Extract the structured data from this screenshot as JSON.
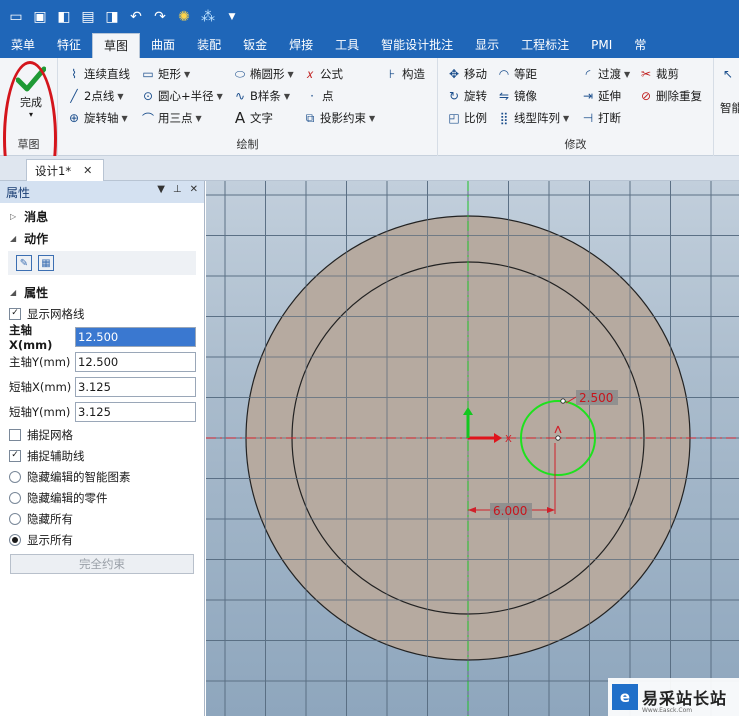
{
  "quick_access": [
    "new-icon",
    "open-icon",
    "save-icon",
    "folder-icon",
    "disk-icon",
    "undo-icon",
    "redo-icon",
    "gear-icon",
    "sparkle-icon",
    "dropdown-icon"
  ],
  "menu": {
    "tabs": [
      "菜单",
      "特征",
      "草图",
      "曲面",
      "装配",
      "钣金",
      "焊接",
      "工具",
      "智能设计批注",
      "显示",
      "工程标注",
      "PMI",
      "常"
    ],
    "active_index": 2
  },
  "ribbon": {
    "finish": {
      "label": "完成",
      "group": "草图"
    },
    "draw": {
      "group": "绘制",
      "items": [
        "连续直线",
        "矩形",
        "椭圆形",
        "公式",
        "构造",
        "2点线",
        "圆心+半径",
        "B样条",
        "点",
        "旋转轴",
        "用三点",
        "文字",
        "投影约束"
      ]
    },
    "modify": {
      "group": "修改",
      "items": [
        "移动",
        "等距",
        "过渡",
        "裁剪",
        "旋转",
        "镜像",
        "延伸",
        "删除重复",
        "比例",
        "线型阵列",
        "打断"
      ]
    },
    "extra": "智能"
  },
  "document": {
    "tab": "设计1*"
  },
  "panel": {
    "title": "属性",
    "sections": {
      "messages": "消息",
      "actions": "动作",
      "properties": "属性"
    },
    "show_grid": {
      "label": "显示网格线",
      "checked": true
    },
    "fields": [
      {
        "label": "主轴X(mm)",
        "value": "12.500"
      },
      {
        "label": "主轴Y(mm)",
        "value": "12.500"
      },
      {
        "label": "短轴X(mm)",
        "value": "3.125"
      },
      {
        "label": "短轴Y(mm)",
        "value": "3.125"
      }
    ],
    "snap_grid": {
      "label": "捕捉网格",
      "checked": false
    },
    "snap_guide": {
      "label": "捕捉辅助线",
      "checked": true
    },
    "radios": [
      {
        "label": "隐藏编辑的智能图素",
        "checked": false
      },
      {
        "label": "隐藏编辑的零件",
        "checked": false
      },
      {
        "label": "隐藏所有",
        "checked": false
      },
      {
        "label": "显示所有",
        "checked": true
      }
    ],
    "full_constraint": "完全约束"
  },
  "canvas": {
    "dim_radius": "2.500",
    "dim_offset": "6.000",
    "axis_x_label": "X"
  },
  "watermark": {
    "mark": "e",
    "text": "易采站长站",
    "sub": "Www.Easck.Com"
  }
}
